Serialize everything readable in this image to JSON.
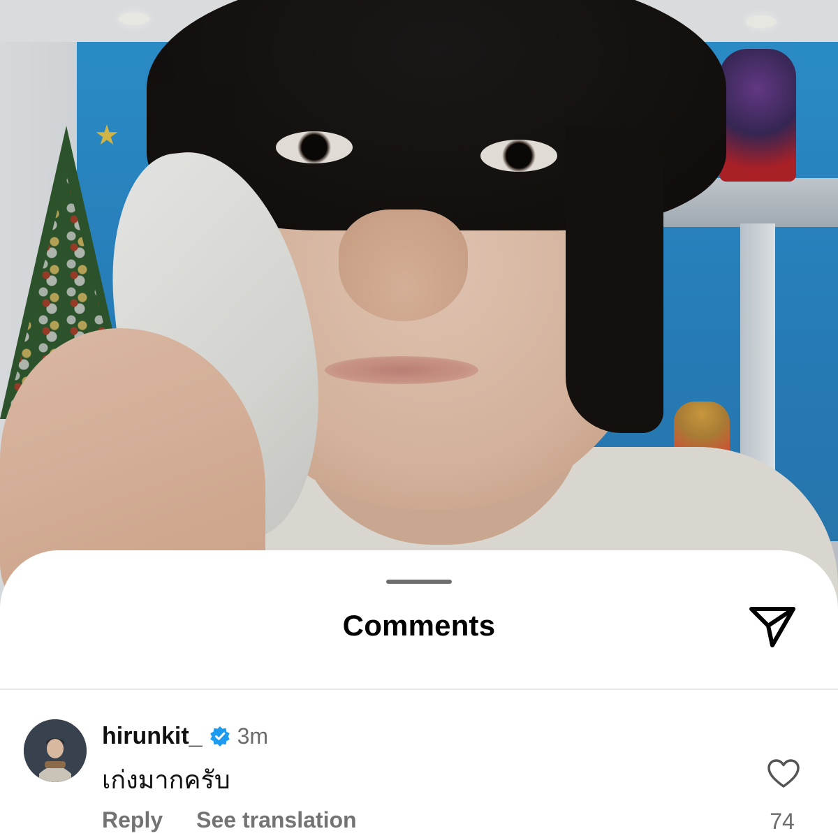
{
  "sheet": {
    "title": "Comments"
  },
  "comment": {
    "username": "hirunkit_",
    "verified": true,
    "timestamp": "3m",
    "text": "เก่งมากครับ",
    "actions": {
      "reply_label": "Reply",
      "translate_label": "See translation"
    },
    "like_count": "74"
  },
  "icons": {
    "share": "paper-plane-icon",
    "verified": "verified-badge-icon",
    "like": "heart-outline-icon",
    "grabber": "drag-handle"
  },
  "colors": {
    "verified_blue": "#1d9bf0",
    "sheet_background": "#ffffff",
    "muted_text": "#737373"
  }
}
